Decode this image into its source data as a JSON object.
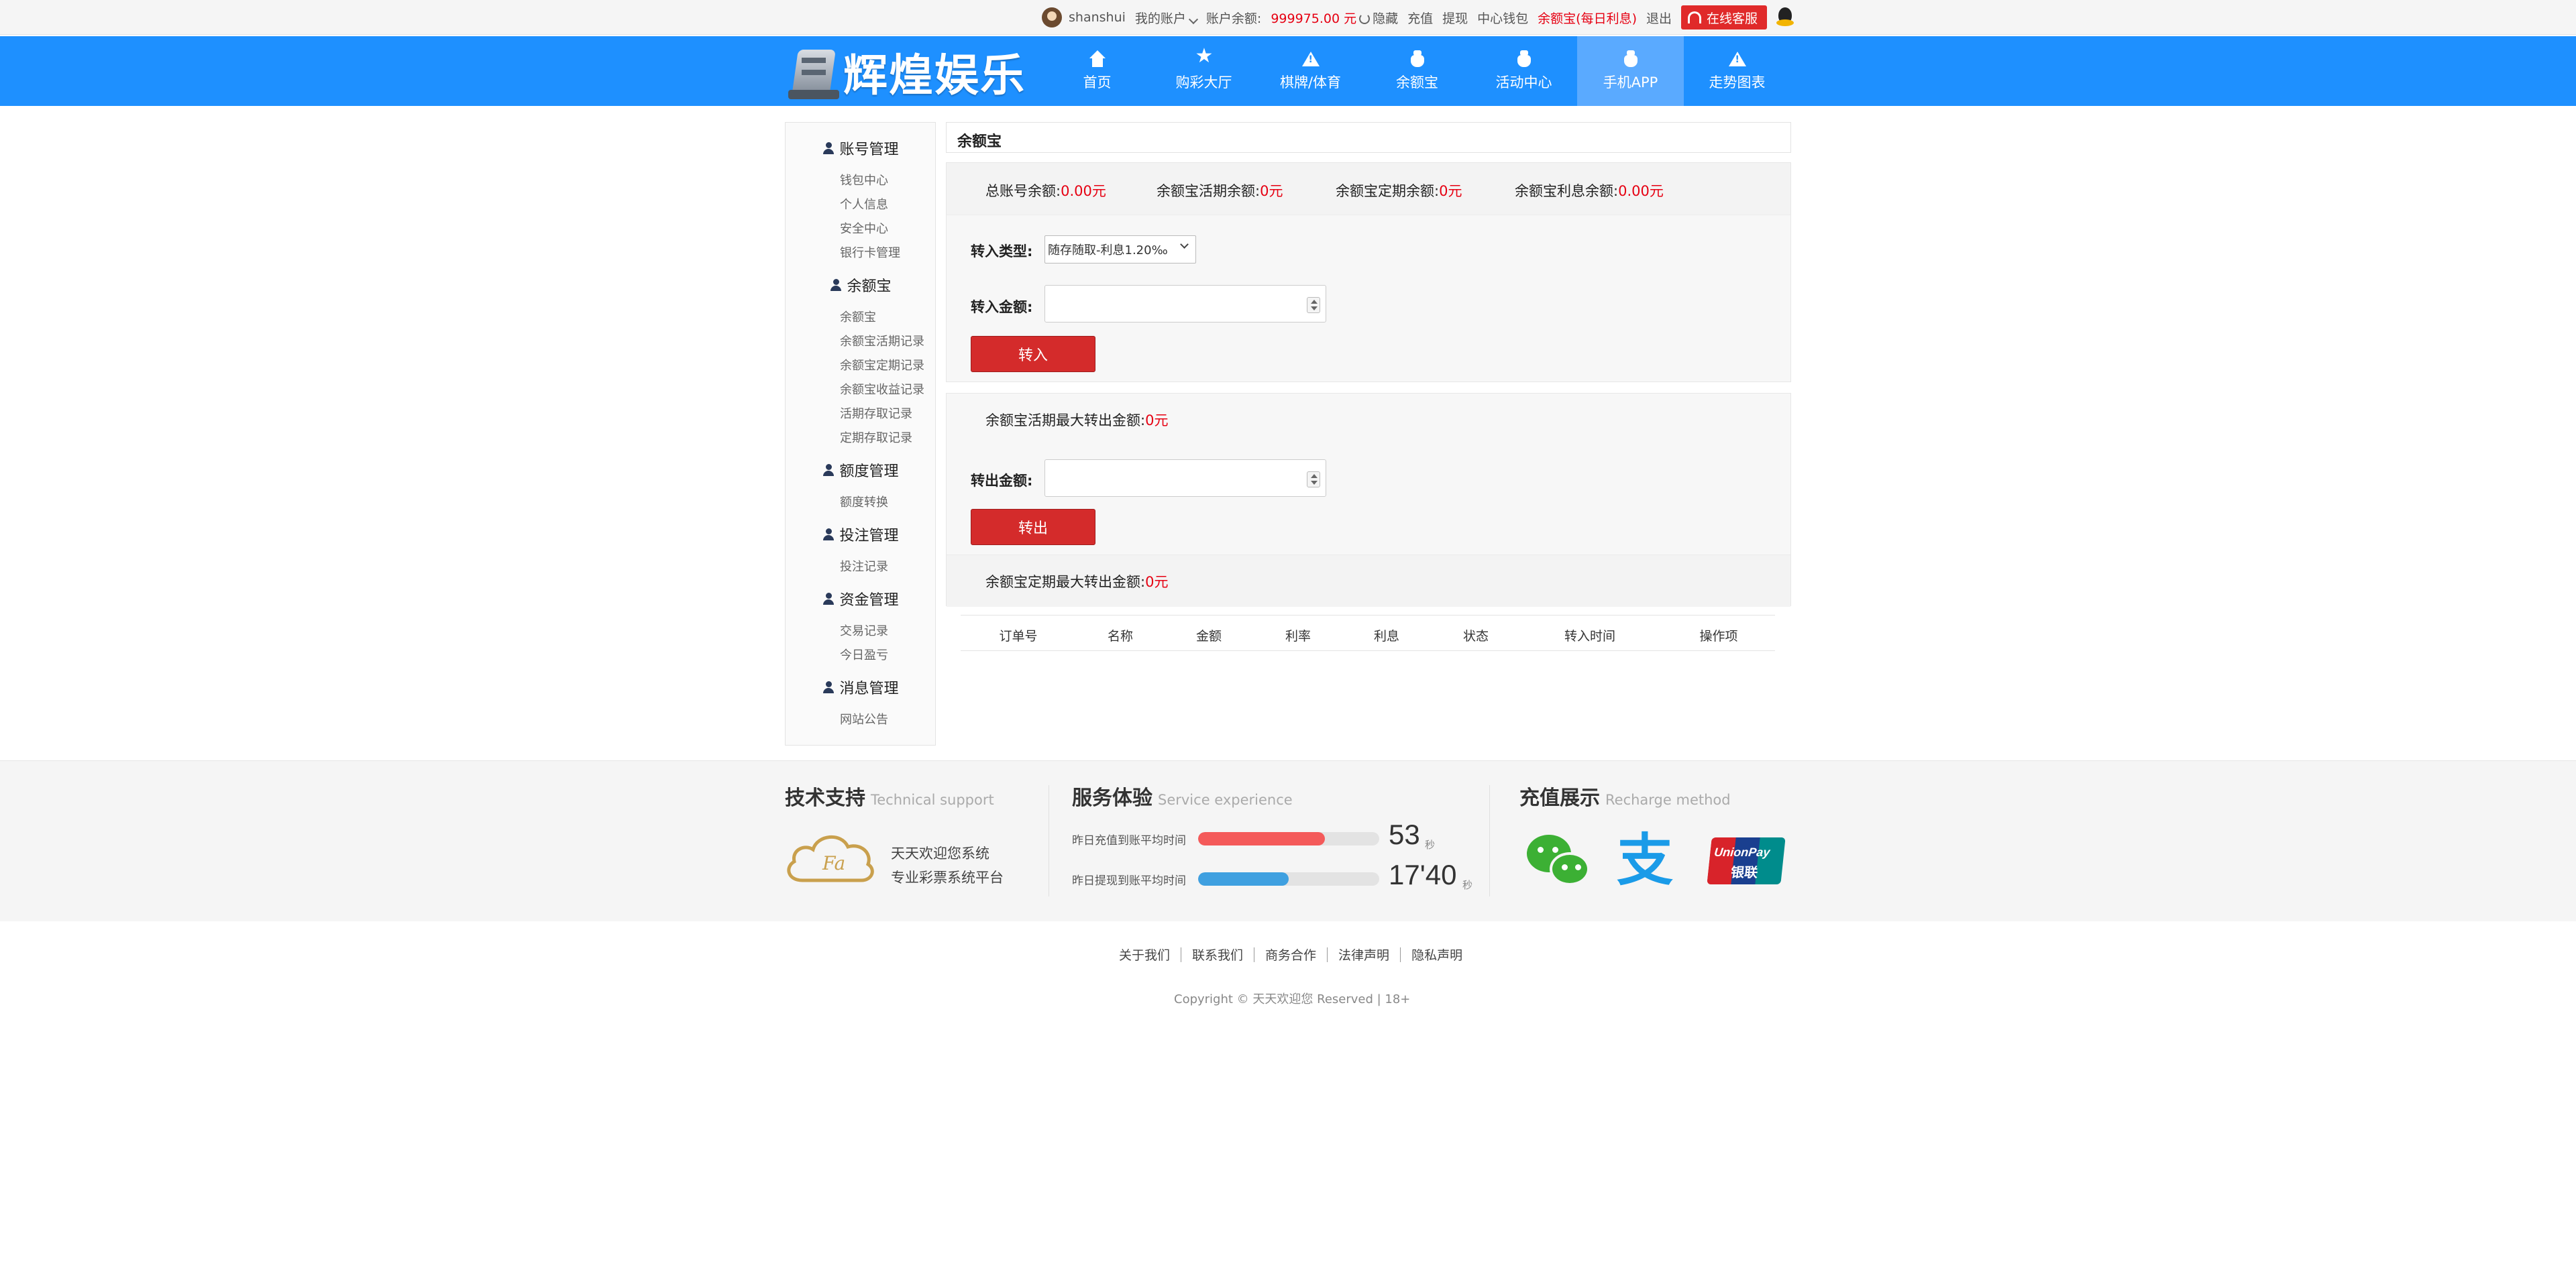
{
  "topbar": {
    "username": "shanshui",
    "my_account": "我的账户",
    "balance_label": "账户余额:",
    "balance_value": "999975.00 元",
    "hide": "隐藏",
    "recharge": "充值",
    "withdraw": "提现",
    "wallet_center": "中心钱包",
    "yuebao_link": "余额宝(每日利息)",
    "logout": "退出",
    "online_service": "在线客服"
  },
  "logo": {
    "text": "辉煌娱乐"
  },
  "nav": {
    "items": [
      {
        "label": "首页",
        "icon": "home-icon"
      },
      {
        "label": "购彩大厅",
        "icon": "star-icon"
      },
      {
        "label": "棋牌/体育",
        "icon": "warning-triangle-icon"
      },
      {
        "label": "余额宝",
        "icon": "money-bag-icon"
      },
      {
        "label": "活动中心",
        "icon": "money-bag-icon"
      },
      {
        "label": "手机APP",
        "icon": "money-bag-icon",
        "active": true
      },
      {
        "label": "走势图表",
        "icon": "warning-triangle-icon"
      }
    ]
  },
  "sidebar": {
    "groups": [
      {
        "title": "账号管理",
        "items": [
          "钱包中心",
          "个人信息",
          "安全中心",
          "银行卡管理"
        ]
      },
      {
        "title": "余额宝",
        "items": [
          "余额宝",
          "余额宝活期记录",
          "余额宝定期记录",
          "余额宝收益记录",
          "活期存取记录",
          "定期存取记录"
        ]
      },
      {
        "title": "额度管理",
        "items": [
          "额度转换"
        ]
      },
      {
        "title": "投注管理",
        "items": [
          "投注记录"
        ]
      },
      {
        "title": "资金管理",
        "items": [
          "交易记录",
          "今日盈亏"
        ]
      },
      {
        "title": "消息管理",
        "items": [
          "网站公告"
        ]
      }
    ]
  },
  "main": {
    "title": "余额宝",
    "summary": [
      {
        "label": "总账号余额:",
        "value": "0.00元"
      },
      {
        "label": "余额宝活期余额:",
        "value": "0元"
      },
      {
        "label": "余额宝定期余额:",
        "value": "0元"
      },
      {
        "label": "余额宝利息余额:",
        "value": "0.00元"
      }
    ],
    "transfer_in": {
      "type_label": "转入类型:",
      "type_selected": "随存随取-利息1.20‰",
      "amount_label": "转入金额:",
      "amount_value": "",
      "button": "转入"
    },
    "transfer_out": {
      "max_label": "余额宝活期最大转出金额:",
      "max_value": "0元",
      "amount_label": "转出金额:",
      "amount_value": "",
      "button": "转出"
    },
    "fixed_max": {
      "label": "余额宝定期最大转出金额:",
      "value": "0元"
    },
    "table": {
      "columns": [
        "订单号",
        "名称",
        "金额",
        "利率",
        "利息",
        "状态",
        "转入时间",
        "操作项"
      ],
      "rows": []
    }
  },
  "footer_info": {
    "tech": {
      "title": "技术支持",
      "title_en": "Technical support",
      "logo_text": "Fa",
      "line1": "天天欢迎您系统",
      "line2": "专业彩票系统平台"
    },
    "service": {
      "title": "服务体验",
      "title_en": "Service experience",
      "stats": [
        {
          "label": "昨日充值到账平均时间",
          "value": "53",
          "unit": "秒",
          "fill_percent": 70,
          "color": "#f45a5a"
        },
        {
          "label": "昨日提现到账平均时间",
          "value": "17'40",
          "unit": "秒",
          "fill_percent": 50,
          "color": "#3fa0e0"
        }
      ]
    },
    "recharge": {
      "title": "充值展示",
      "title_en": "Recharge method",
      "methods": [
        "wechat-pay-icon",
        "alipay-icon",
        "unionpay-icon"
      ],
      "alipay_glyph": "支",
      "unionpay_en": "UnionPay",
      "unionpay_cn": "银联"
    }
  },
  "bottom": {
    "links": [
      "关于我们",
      "联系我们",
      "商务合作",
      "法律声明",
      "隐私声明"
    ],
    "copyright": "Copyright © 天天欢迎您 Reserved | 18+"
  }
}
